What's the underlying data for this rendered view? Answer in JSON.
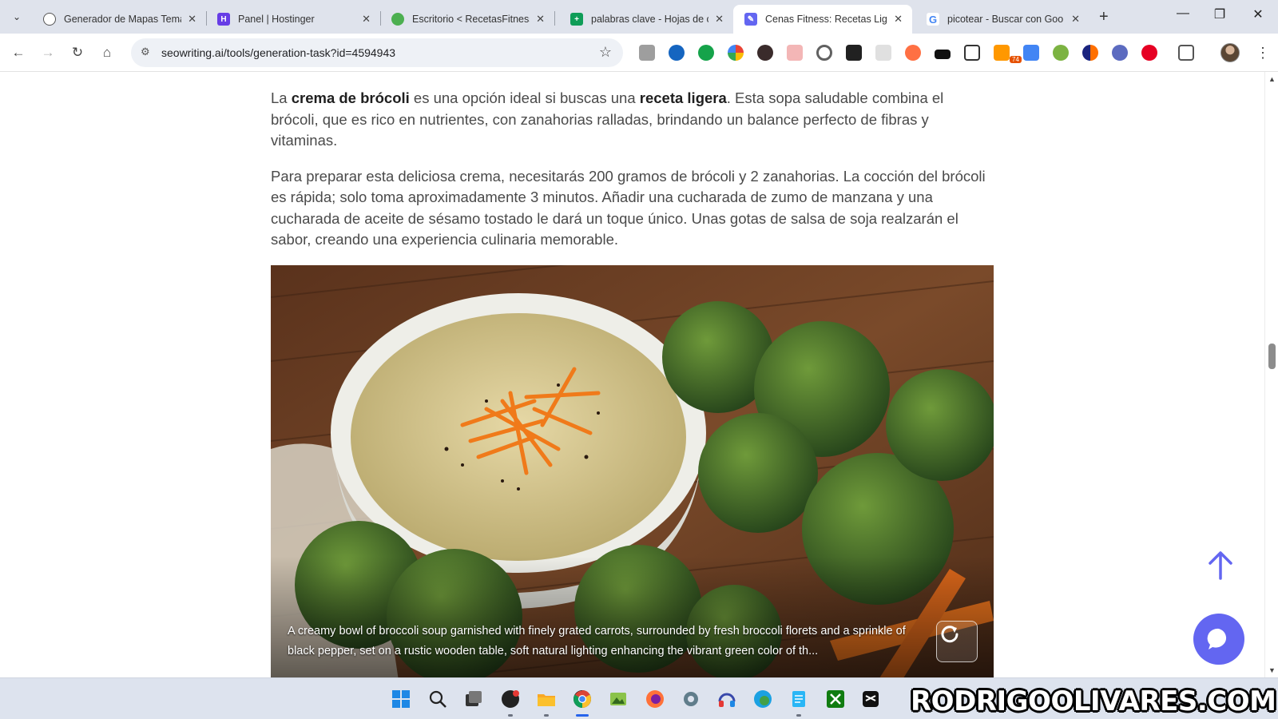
{
  "browser": {
    "tabs": [
      {
        "title": "Generador de Mapas Temá",
        "favicon": "openai-icon",
        "active": false
      },
      {
        "title": "Panel | Hostinger",
        "favicon": "hostinger-icon",
        "active": false
      },
      {
        "title": "Escritorio < RecetasFitness",
        "favicon": "wordpress-icon",
        "active": false
      },
      {
        "title": "palabras clave - Hojas de c",
        "favicon": "sheets-icon",
        "active": false
      },
      {
        "title": "Cenas Fitness: Recetas Lige",
        "favicon": "seowriting-icon",
        "active": true
      },
      {
        "title": "picotear - Buscar con Goo",
        "favicon": "google-icon",
        "active": false
      }
    ],
    "url": "seowriting.ai/tools/generation-task?id=4594943",
    "extension_badge": "74"
  },
  "article": {
    "p1": {
      "before": "La ",
      "b1": "crema de brócoli",
      "mid": " es una opción ideal si buscas una ",
      "b2": "receta ligera",
      "after": ". Esta sopa saludable combina el brócoli, que es rico en nutrientes, con zanahorias ralladas, brindando un balance perfecto de fibras y vitaminas."
    },
    "p2": "Para preparar esta deliciosa crema, necesitarás 200 gramos de brócoli y 2 zanahorias. La cocción del brócoli es rápida; solo toma aproximadamente 3 minutos. Añadir una cucharada de zumo de manzana y una cucharada de aceite de sésamo tostado le dará un toque único. Unas gotas de salsa de soja realzarán el sabor, creando una experiencia culinaria memorable.",
    "image_caption": "A creamy bowl of broccoli soup garnished with finely grated carrots, surrounded by fresh broccoli florets and a sprinkle of black pepper, set on a rustic wooden table, soft natural lighting enhancing the vibrant green color of th..."
  },
  "watermark": "RODRIGOOLIVARES.COM",
  "colors": {
    "accent": "#6366f1",
    "text": "#4a4a4a",
    "bold_text": "#1f1f1f"
  }
}
